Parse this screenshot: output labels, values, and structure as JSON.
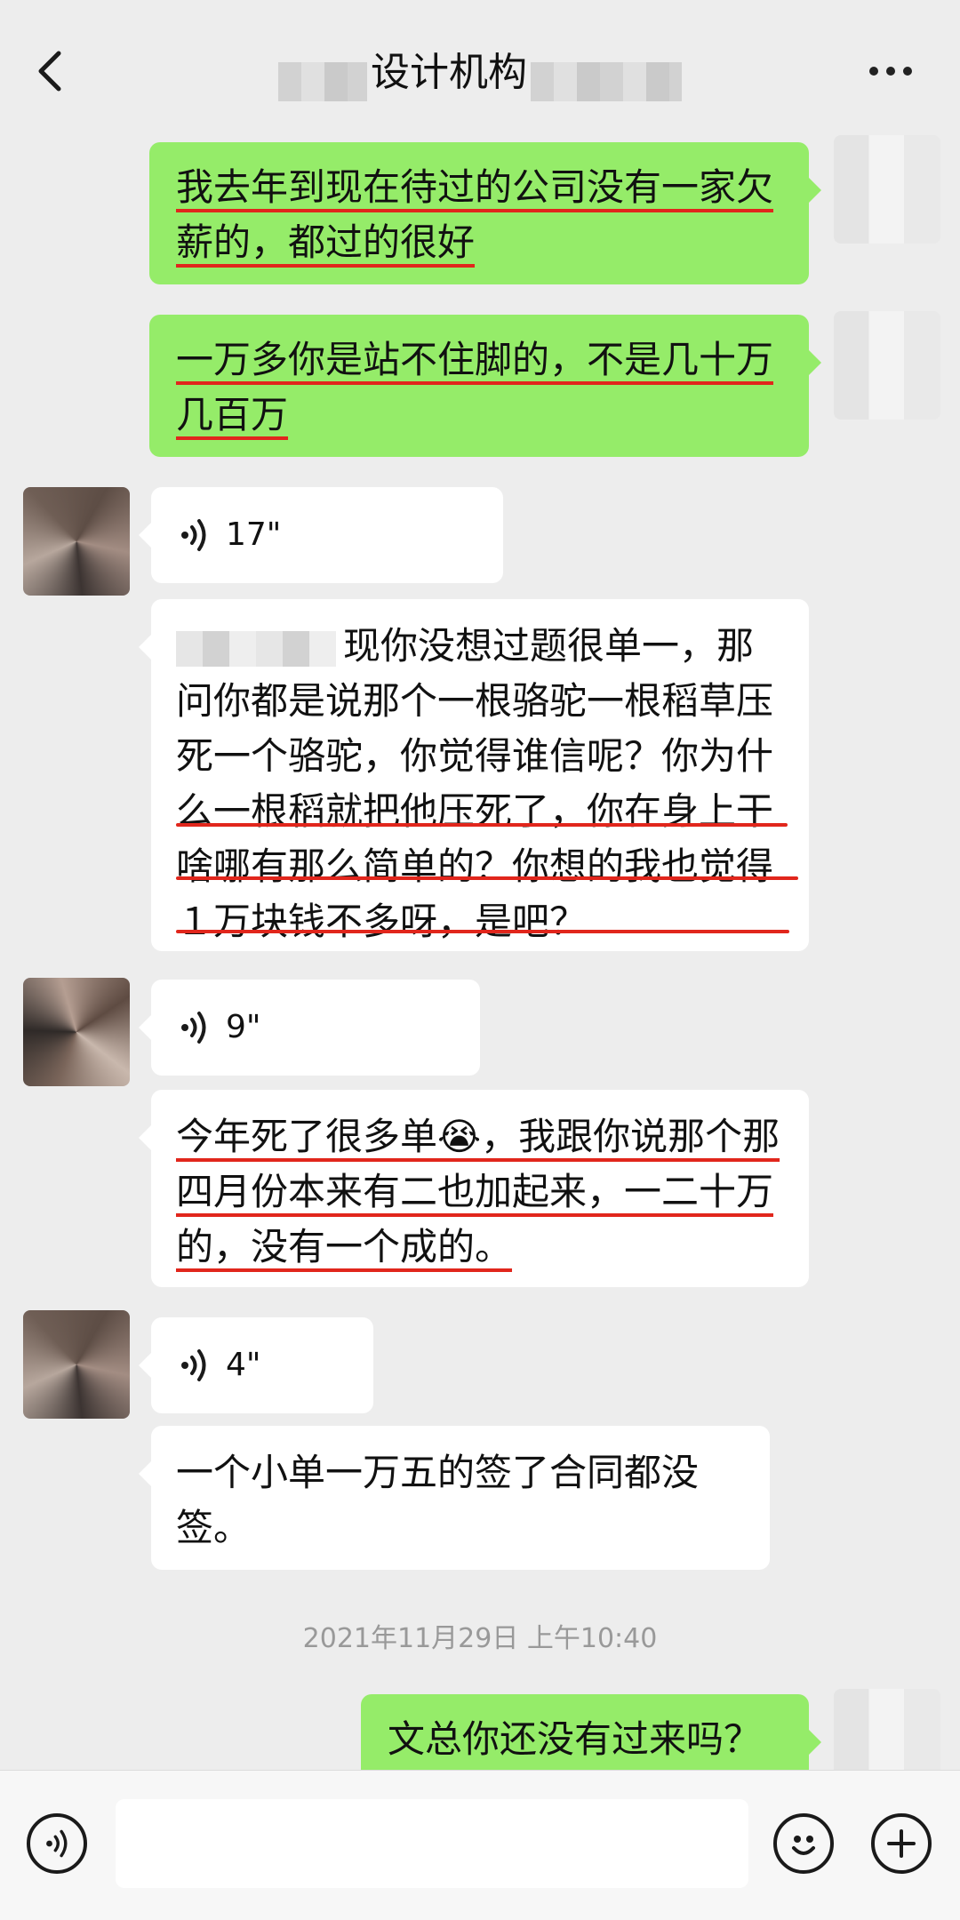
{
  "header": {
    "title": "设计机构",
    "back_icon": "chevron-left-icon",
    "more_icon": "more-dots-icon"
  },
  "messages": [
    {
      "side": "right",
      "type": "text",
      "text": "我去年到现在待过的公司没有一家欠薪的，都过的很好"
    },
    {
      "side": "right",
      "type": "text",
      "text": "一万多你是站不住脚的，不是几十万几百万"
    },
    {
      "side": "left",
      "type": "voice",
      "duration": "17\""
    },
    {
      "side": "left",
      "type": "text",
      "text": "现你没想过题很单一，那问你都是说那个一根骆驼一根稻草压死一个骆驼，你觉得谁信呢？你为什么一根稻就把他压死了，你在身上干啥哪有那么简单的？你想的我也觉得１万块钱不多呀，是吧？"
    },
    {
      "side": "left",
      "type": "voice",
      "duration": "9\""
    },
    {
      "side": "left",
      "type": "text",
      "text": "今年死了很多单😭，我跟你说那个那四月份本来有二也加起来，一二十万的，没有一个成的。"
    },
    {
      "side": "left",
      "type": "voice",
      "duration": "4\""
    },
    {
      "side": "left",
      "type": "text",
      "text": "一个小单一万五的签了合同都没签。"
    },
    {
      "side": "center",
      "type": "timestamp",
      "text": "2021年11月29日 上午10:40"
    },
    {
      "side": "right",
      "type": "text",
      "text": "文总你还没有过来吗？"
    }
  ],
  "bottom_bar": {
    "voice_icon": "voice-input-icon",
    "emoji_icon": "emoji-icon",
    "plus_icon": "plus-icon"
  },
  "colors": {
    "sent_bubble": "#95ec69",
    "received_bubble": "#ffffff",
    "background": "#ededed",
    "underline": "#e1261c"
  }
}
